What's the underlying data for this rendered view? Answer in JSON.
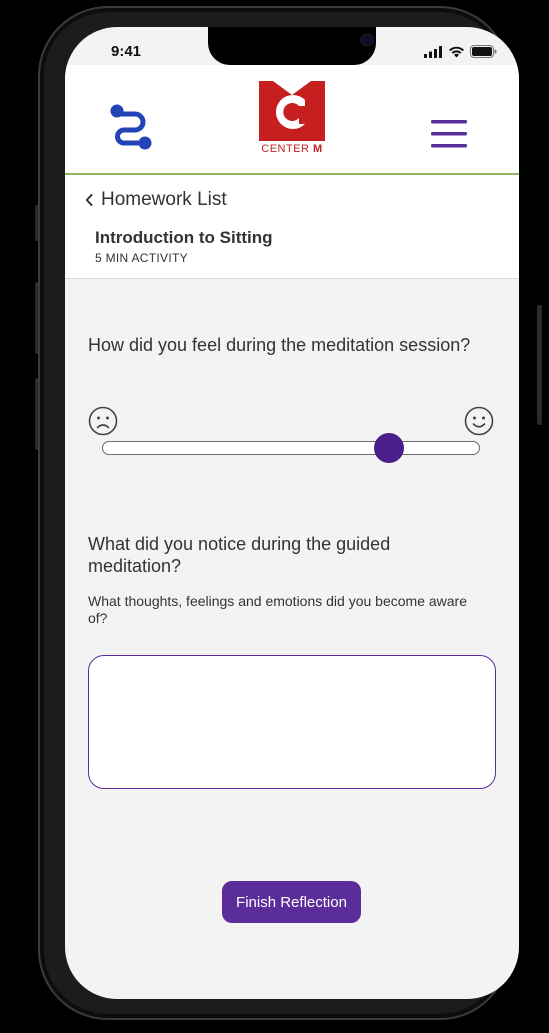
{
  "status_bar": {
    "time": "9:41"
  },
  "header": {
    "logo_text_center": "CENTER ",
    "logo_text_m": "M",
    "colors": {
      "logo_red": "#c51f1f",
      "menu_purple": "#5a2d9a",
      "route_blue": "#2244b8",
      "divider_green": "#8fb55e"
    }
  },
  "nav": {
    "back_label": "Homework List",
    "activity_title": "Introduction to Sitting",
    "activity_subtitle": "5 MIN ACTIVITY"
  },
  "reflection": {
    "question_1": "How did you feel during the meditation session?",
    "slider": {
      "value": 0.77,
      "min_icon": "sad-face-icon",
      "max_icon": "happy-face-icon"
    },
    "question_2": "What did you notice during the guided meditation?",
    "question_2_hint": "What thoughts, feelings and emotions did you become aware of?",
    "answer_value": "",
    "answer_placeholder": ""
  },
  "actions": {
    "finish_label": "Finish Reflection",
    "accent": "#5a2d9a"
  }
}
